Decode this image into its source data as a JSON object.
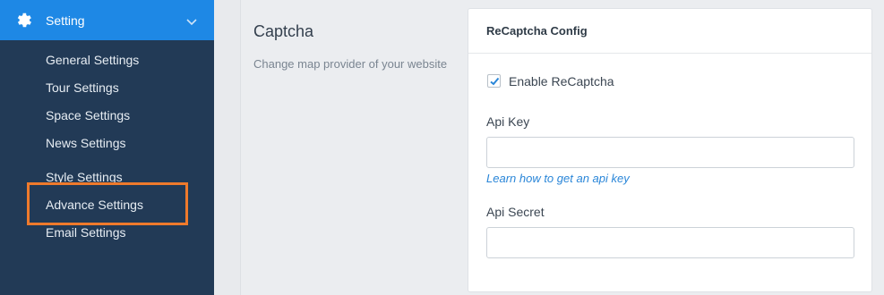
{
  "sidebar": {
    "header": {
      "label": "Setting",
      "icon": "gear-icon",
      "expand_icon": "chevron-down-icon"
    },
    "items": [
      {
        "label": "General Settings"
      },
      {
        "label": "Tour Settings"
      },
      {
        "label": "Space Settings"
      },
      {
        "label": "News Settings"
      },
      {
        "label": "Style Settings"
      },
      {
        "label": "Advance Settings",
        "highlighted": true
      },
      {
        "label": "Email Settings"
      }
    ]
  },
  "section": {
    "title": "Captcha",
    "description": "Change map provider of your website"
  },
  "card": {
    "title": "ReCaptcha Config",
    "enable": {
      "label": "Enable ReCaptcha",
      "checked": true
    },
    "api_key": {
      "label": "Api Key",
      "value": "",
      "help_link": "Learn how to get an api key"
    },
    "api_secret": {
      "label": "Api Secret",
      "value": ""
    }
  },
  "colors": {
    "sidebar_bg": "#223a56",
    "header_bg": "#1e88e5",
    "highlight": "#ef7a2c",
    "link": "#2a86d8"
  }
}
